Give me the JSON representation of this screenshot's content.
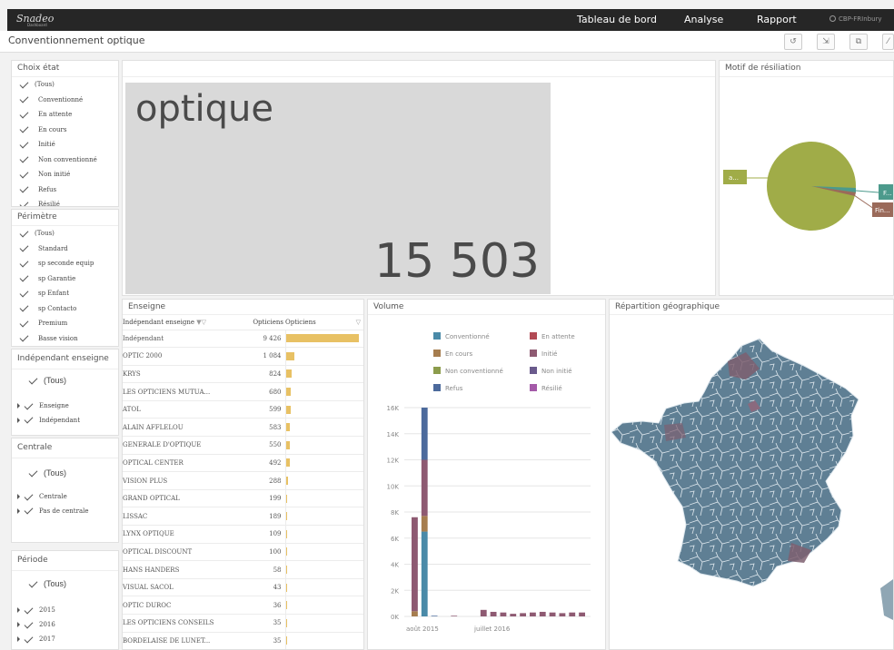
{
  "topbar": {
    "logo": "Snadeo",
    "logo_sub": "Dashboard",
    "nav": [
      "Tableau de bord",
      "Analyse",
      "Rapport"
    ],
    "user": "CBP-FRInbury"
  },
  "subheader": {
    "title": "Conventionnement optique",
    "buttons": [
      "history-icon",
      "export-icon",
      "fullscreen-icon",
      "more-icon"
    ]
  },
  "filters": {
    "etat": {
      "title": "Choix état",
      "items": [
        "(Tous)",
        "Conventionné",
        "En attente",
        "En cours",
        "Initié",
        "Non conventionné",
        "Non initié",
        "Refus",
        "Résilié"
      ]
    },
    "perimetre": {
      "title": "Périmètre",
      "items": [
        "(Tous)",
        "Standard",
        "sp seconde equip",
        "sp Garantie",
        "sp Enfant",
        "sp Contacto",
        "Premium",
        "Basse vision"
      ]
    },
    "independant": {
      "title": "Indépendant enseigne",
      "all": "(Tous)",
      "items": [
        "Enseigne",
        "Indépendant"
      ]
    },
    "centrale": {
      "title": "Centrale",
      "all": "(Tous)",
      "items": [
        "Centrale",
        "Pas de centrale"
      ]
    },
    "periode": {
      "title": "Période",
      "all": "(Tous)",
      "items": [
        "2015",
        "2016",
        "2017"
      ]
    }
  },
  "kpi": {
    "label": "optique",
    "value": "15 503"
  },
  "motif": {
    "title": "Motif de résiliation",
    "labels": [
      "a...",
      "F...",
      "Fin..."
    ]
  },
  "enseigne": {
    "title": "Enseigne",
    "headers": [
      "Indépendant enseigne",
      "Opticiens",
      "Opticiens"
    ],
    "rows": [
      {
        "name": "Indépendant",
        "value": "9 426",
        "n": 9426
      },
      {
        "name": "OPTIC 2000",
        "value": "1 084",
        "n": 1084
      },
      {
        "name": "KRYS",
        "value": "824",
        "n": 824
      },
      {
        "name": "LES OPTICIENS MUTUA...",
        "value": "680",
        "n": 680
      },
      {
        "name": "ATOL",
        "value": "599",
        "n": 599
      },
      {
        "name": "ALAIN AFFLELOU",
        "value": "583",
        "n": 583
      },
      {
        "name": "GENERALE D'OPTIQUE",
        "value": "550",
        "n": 550
      },
      {
        "name": "OPTICAL CENTER",
        "value": "492",
        "n": 492
      },
      {
        "name": "VISION PLUS",
        "value": "288",
        "n": 288
      },
      {
        "name": "GRAND OPTICAL",
        "value": "199",
        "n": 199
      },
      {
        "name": "LISSAC",
        "value": "189",
        "n": 189
      },
      {
        "name": "LYNX OPTIQUE",
        "value": "109",
        "n": 109
      },
      {
        "name": "OPTICAL DISCOUNT",
        "value": "100",
        "n": 100
      },
      {
        "name": "HANS HANDERS",
        "value": "58",
        "n": 58
      },
      {
        "name": "VISUAL SACOL",
        "value": "43",
        "n": 43
      },
      {
        "name": "OPTIC DUROC",
        "value": "36",
        "n": 36
      },
      {
        "name": "LES OPTICIENS CONSEILS",
        "value": "35",
        "n": 35
      },
      {
        "name": "BORDELAISE DE LUNET...",
        "value": "35",
        "n": 35
      }
    ]
  },
  "volume": {
    "title": "Volume",
    "legend": [
      {
        "name": "Conventionné",
        "color": "#4a8aa8"
      },
      {
        "name": "En attente",
        "color": "#b24a55"
      },
      {
        "name": "En cours",
        "color": "#a67d4f"
      },
      {
        "name": "Initié",
        "color": "#8e5a72"
      },
      {
        "name": "Non conventionné",
        "color": "#8c9c4c"
      },
      {
        "name": "Non initié",
        "color": "#6a5a8c"
      },
      {
        "name": "Refus",
        "color": "#4c6a9c"
      },
      {
        "name": "Résilié",
        "color": "#a45aa8"
      }
    ],
    "y_ticks": [
      "0K",
      "2K",
      "4K",
      "6K",
      "8K",
      "10K",
      "12K",
      "14K",
      "16K"
    ],
    "x_ticks": [
      "août 2015",
      "juillet 2016"
    ]
  },
  "geo": {
    "title": "Répartition géographique"
  },
  "chart_data": {
    "type": "bar",
    "title": "Volume",
    "xlabel": "",
    "ylabel": "",
    "ylim": [
      0,
      17000
    ],
    "categories": [
      "août 2015",
      "sep. 2015",
      "oct. 2015",
      "nov. 2015",
      "déc. 2015",
      "jan. 2016",
      "fév. 2016",
      "mars 2016",
      "avr. 2016",
      "mai 2016",
      "juin 2016",
      "juillet 2016",
      "août 2016",
      "sep. 2016",
      "oct. 2016",
      "nov. 2016",
      "déc. 2016",
      "jan. 2017"
    ],
    "stacked": true,
    "series": [
      {
        "name": "Conventionné",
        "values": [
          0,
          6500,
          0,
          0,
          0,
          0,
          0,
          0,
          0,
          0,
          0,
          0,
          0,
          0,
          0,
          0,
          0,
          0
        ]
      },
      {
        "name": "En cours",
        "values": [
          400,
          1200,
          0,
          0,
          0,
          0,
          0,
          0,
          0,
          0,
          0,
          0,
          0,
          0,
          0,
          0,
          0,
          0
        ]
      },
      {
        "name": "Initié",
        "values": [
          7200,
          4300,
          0,
          0,
          50,
          0,
          0,
          500,
          350,
          300,
          200,
          250,
          300,
          350,
          300,
          250,
          300,
          300
        ]
      },
      {
        "name": "Refus",
        "values": [
          0,
          4000,
          50,
          0,
          0,
          0,
          0,
          0,
          0,
          0,
          0,
          0,
          0,
          0,
          0,
          0,
          0,
          0
        ]
      }
    ]
  }
}
